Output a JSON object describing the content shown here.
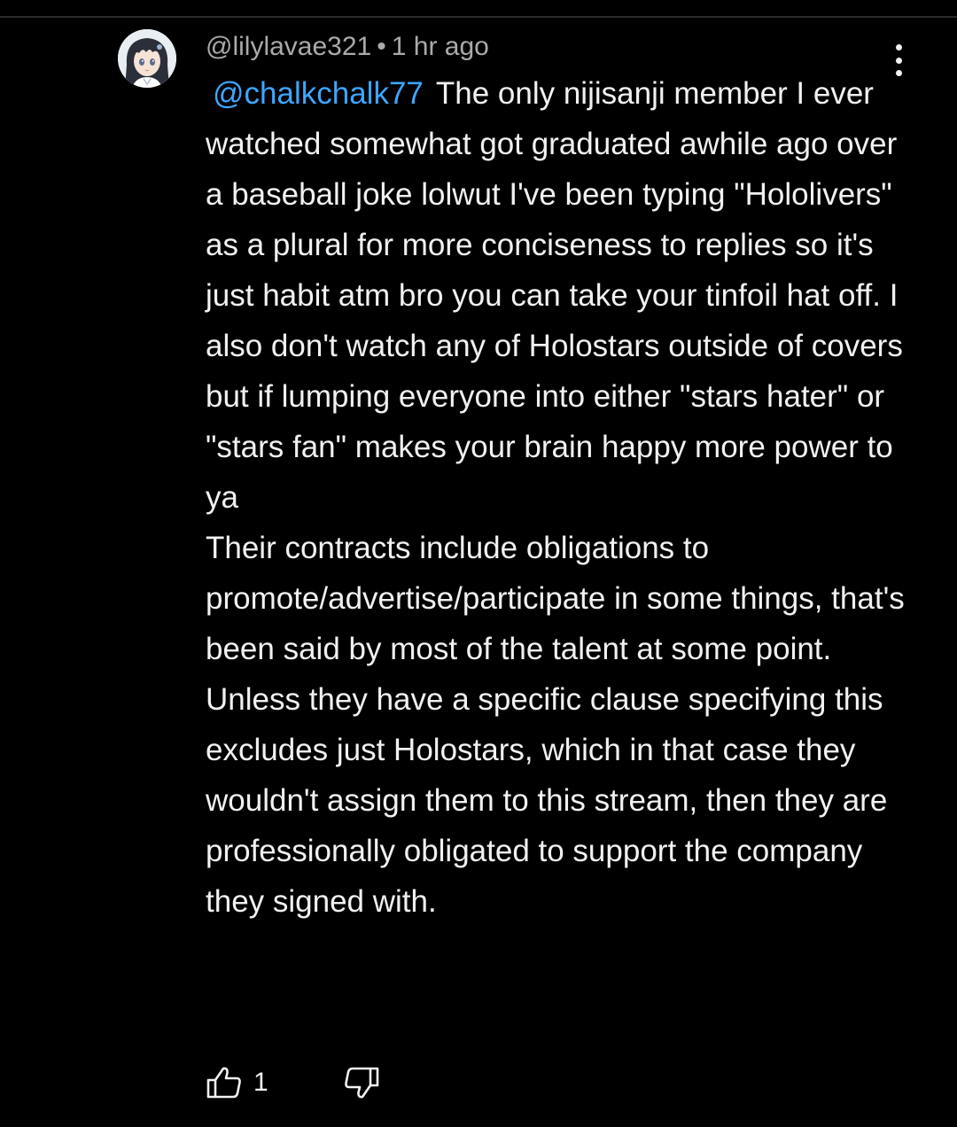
{
  "comment": {
    "avatar_icon": "anime-character-avatar",
    "author": "@lilylavae321",
    "separator": "•",
    "timestamp": "1 hr ago",
    "mention": "@chalkchalk77",
    "text_paragraph_1": "The only nijisanji member I ever watched somewhat got graduated awhile ago over a baseball joke lolwut I've been typing \"Hololivers\" as a plural for more conciseness to replies so it's just habit atm bro you can take your tinfoil hat off. I also don't watch any of Holostars outside of covers but if lumping everyone into either \"stars hater\" or \"stars fan\" makes your brain happy more power to ya",
    "text_paragraph_2": "Their contracts include obligations to promote/advertise/participate in some things, that's been said by most of the talent at some point. Unless they have a specific clause specifying this excludes just Holostars, which in that case they wouldn't assign them to this stream, then they are professionally obligated to support the company they signed with.",
    "like_icon": "thumbs-up-icon",
    "like_count": "1",
    "dislike_icon": "thumbs-down-icon",
    "menu_icon": "more-vertical-icon"
  },
  "colors": {
    "background": "#000000",
    "text": "#f1f1f1",
    "meta": "#aaaaaa",
    "mention": "#3ea6ff"
  }
}
